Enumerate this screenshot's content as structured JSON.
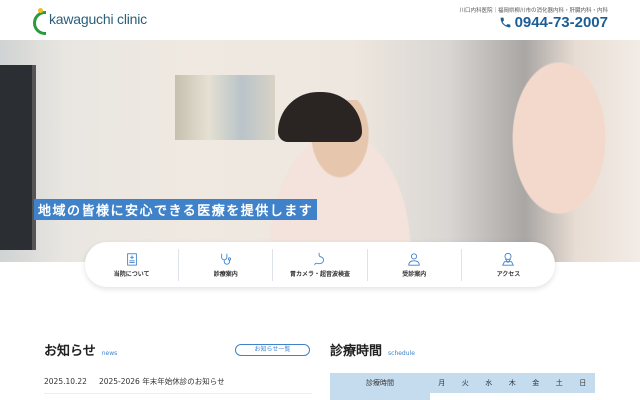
{
  "header": {
    "logo_text": "kawaguchi clinic",
    "tagline": "川口内科医院｜福岡県柳川市の消化器内科・肝臓内科・内科",
    "phone": "0944-73-2007"
  },
  "hero": {
    "caption": "地域の皆様に安心できる医療を提供します"
  },
  "nav": [
    {
      "label": "当院について",
      "icon": "hospital-icon"
    },
    {
      "label": "診療案内",
      "icon": "stethoscope-icon"
    },
    {
      "label": "胃カメラ・超音波検査",
      "icon": "stomach-icon"
    },
    {
      "label": "受診案内",
      "icon": "doctor-icon"
    },
    {
      "label": "アクセス",
      "icon": "map-pin-icon"
    }
  ],
  "news": {
    "title": "お知らせ",
    "sub": "news",
    "button": "お知らせ一覧",
    "items": [
      {
        "date": "2025.10.22",
        "title": "2025-2026 年末年始休診のお知らせ"
      }
    ]
  },
  "schedule": {
    "title": "診療時間",
    "sub": "schedule",
    "header": "診療時間",
    "days": [
      "月",
      "火",
      "水",
      "木",
      "金",
      "土",
      "日"
    ]
  },
  "colors": {
    "accent": "#3f82c9",
    "brand": "#1c5d96"
  }
}
